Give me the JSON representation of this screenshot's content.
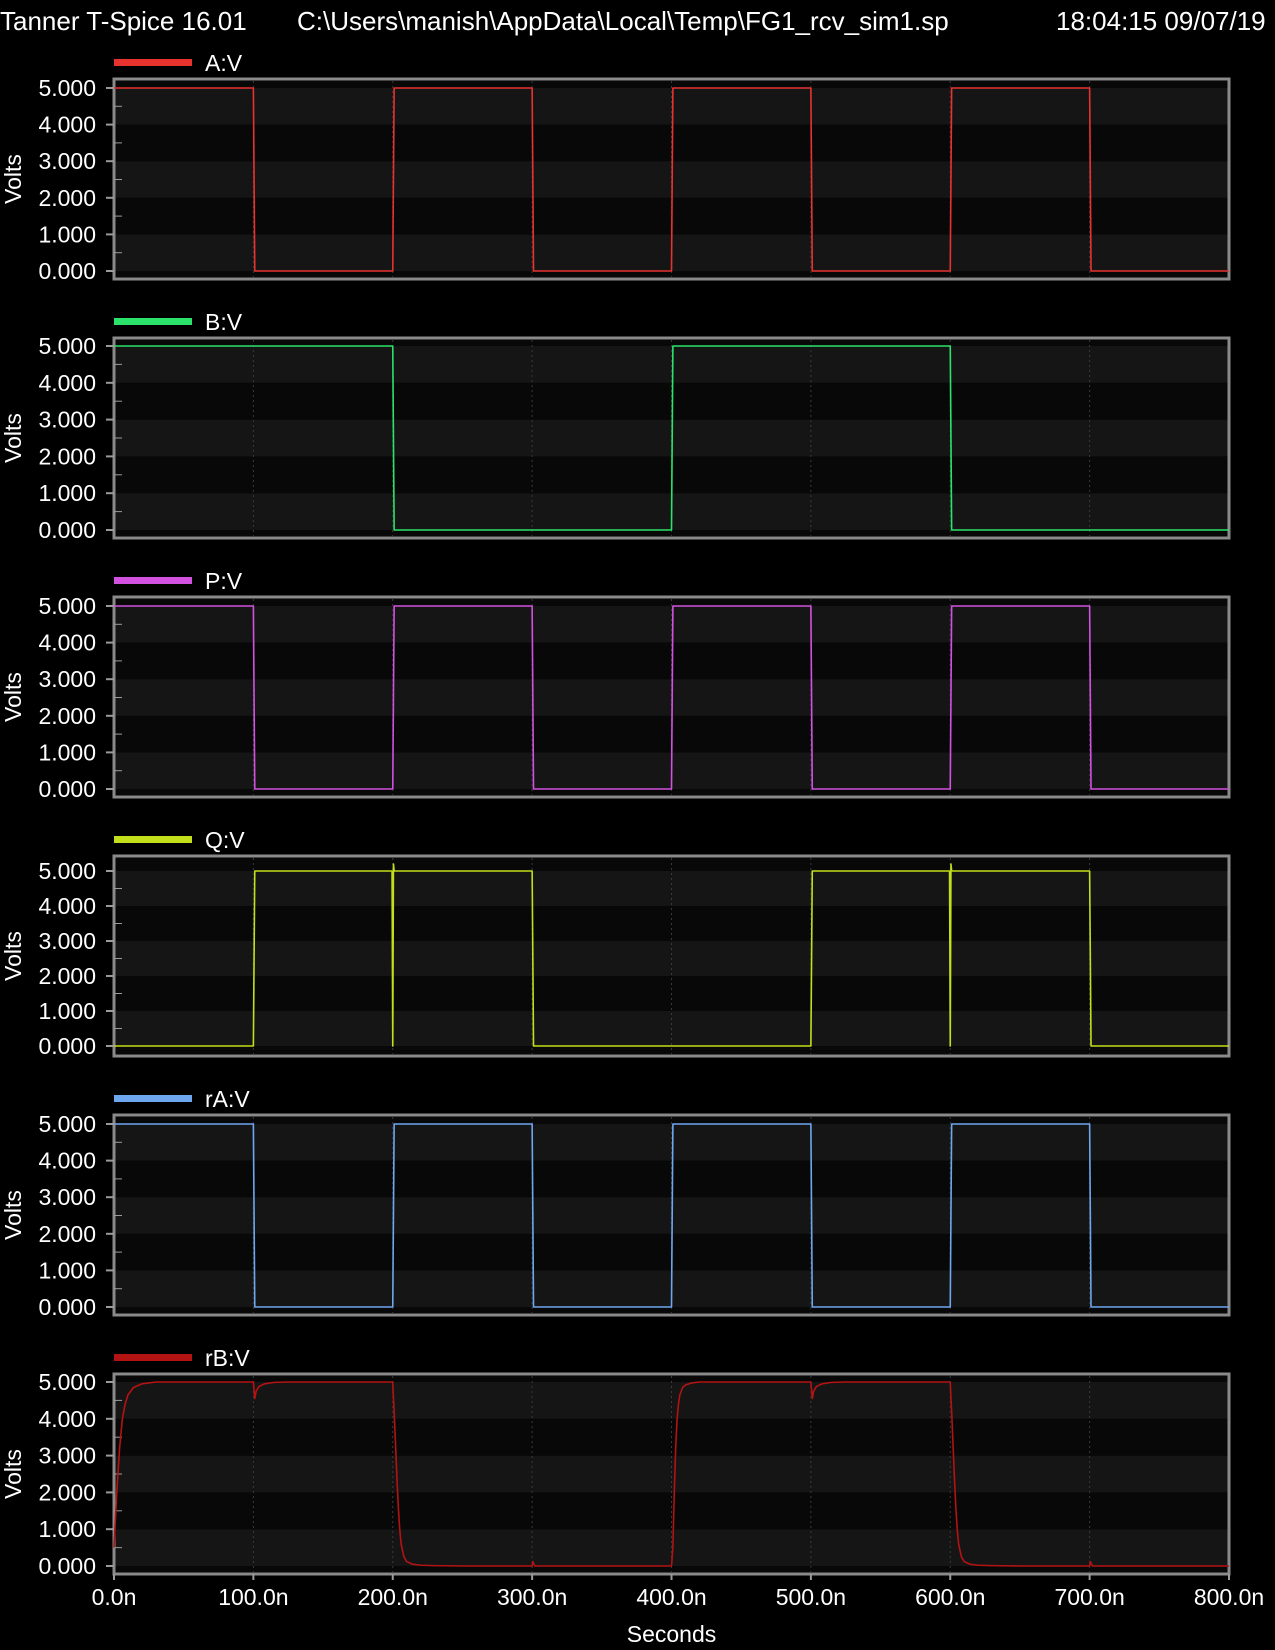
{
  "header": {
    "app": "Tanner T-Spice 16.01",
    "file": "C:\\Users\\manish\\AppData\\Local\\Temp\\FG1_rcv_sim1.sp",
    "timestamp": "18:04:15 09/07/19"
  },
  "chart_data": {
    "type": "line",
    "xlabel": "Seconds",
    "ylabel": "Volts",
    "xlim": [
      0,
      800
    ],
    "ylim": [
      0,
      5
    ],
    "x_unit": "ns",
    "x_ticks": [
      "0.0n",
      "100.0n",
      "200.0n",
      "300.0n",
      "400.0n",
      "500.0n",
      "600.0n",
      "700.0n",
      "800.0n"
    ],
    "y_ticks": [
      "0.000",
      "1.000",
      "2.000",
      "3.000",
      "4.000",
      "5.000"
    ],
    "grid": true,
    "legend_position": "top-left",
    "series": [
      {
        "name": "A:V",
        "color": "#e8322f",
        "x": [
          0,
          100,
          101,
          200,
          201,
          300,
          301,
          400,
          401,
          500,
          501,
          600,
          601,
          700,
          701,
          800
        ],
        "y": [
          5,
          5,
          0,
          0,
          5,
          5,
          0,
          0,
          5,
          5,
          0,
          0,
          5,
          5,
          0,
          0
        ]
      },
      {
        "name": "B:V",
        "color": "#2be36a",
        "x": [
          0,
          200,
          201,
          400,
          401,
          600,
          601,
          800
        ],
        "y": [
          5,
          5,
          0,
          0,
          5,
          5,
          0,
          0
        ]
      },
      {
        "name": "P:V",
        "color": "#d351e0",
        "x": [
          0,
          100,
          101,
          200,
          201,
          300,
          301,
          400,
          401,
          500,
          501,
          600,
          601,
          700,
          701,
          800
        ],
        "y": [
          5,
          5,
          0,
          0,
          5,
          5,
          0,
          0,
          5,
          5,
          0,
          0,
          5,
          5,
          0,
          0
        ]
      },
      {
        "name": "Q:V",
        "color": "#c3de1a",
        "x": [
          0,
          100,
          101,
          199.5,
          200,
          200.5,
          201,
          300,
          301,
          500,
          501,
          599.5,
          600,
          600.5,
          601,
          700,
          701,
          800
        ],
        "y": [
          0,
          0,
          5,
          5,
          0,
          5.2,
          5,
          5,
          0,
          0,
          5,
          5,
          0,
          5.2,
          5,
          5,
          0,
          0
        ]
      },
      {
        "name": "rA:V",
        "color": "#6ea6f0",
        "x": [
          0,
          100,
          101,
          200,
          201,
          300,
          301,
          400,
          401,
          500,
          501,
          600,
          601,
          700,
          701,
          800
        ],
        "y": [
          5,
          5,
          0,
          0,
          5,
          5,
          0,
          0,
          5,
          5,
          0,
          0,
          5,
          5,
          0,
          0
        ]
      },
      {
        "name": "rB:V",
        "color": "#b31313",
        "x": [
          0,
          2,
          4,
          6,
          8,
          10,
          14,
          20,
          30,
          50,
          100,
          101,
          102,
          104,
          108,
          115,
          125,
          200,
          200.5,
          201,
          202,
          203,
          204,
          205,
          206,
          208,
          210,
          214,
          220,
          230,
          250,
          300,
          300.5,
          302,
          400,
          401,
          402,
          403,
          404,
          405,
          406,
          408,
          410,
          414,
          420,
          430,
          450,
          500,
          501,
          502,
          504,
          508,
          515,
          525,
          600,
          600.5,
          601,
          602,
          603,
          604,
          605,
          606,
          608,
          610,
          614,
          620,
          630,
          650,
          700,
          700.5,
          702,
          800
        ],
        "y": [
          0.5,
          2.0,
          3.2,
          4.0,
          4.4,
          4.65,
          4.85,
          4.95,
          5.0,
          5.0,
          5.0,
          4.55,
          4.75,
          4.88,
          4.95,
          4.99,
          5.0,
          5.0,
          4.55,
          4.2,
          3.3,
          2.4,
          1.6,
          1.0,
          0.6,
          0.25,
          0.12,
          0.05,
          0.02,
          0.01,
          0.0,
          0.0,
          0.12,
          0.0,
          0.0,
          0.5,
          2.0,
          3.2,
          4.0,
          4.4,
          4.65,
          4.85,
          4.92,
          4.97,
          5.0,
          5.0,
          5.0,
          5.0,
          4.55,
          4.75,
          4.88,
          4.95,
          4.99,
          5.0,
          5.0,
          4.55,
          4.2,
          3.3,
          2.4,
          1.6,
          1.0,
          0.6,
          0.25,
          0.12,
          0.05,
          0.02,
          0.01,
          0.0,
          0.0,
          0.12,
          0.0,
          0.0
        ]
      }
    ]
  }
}
